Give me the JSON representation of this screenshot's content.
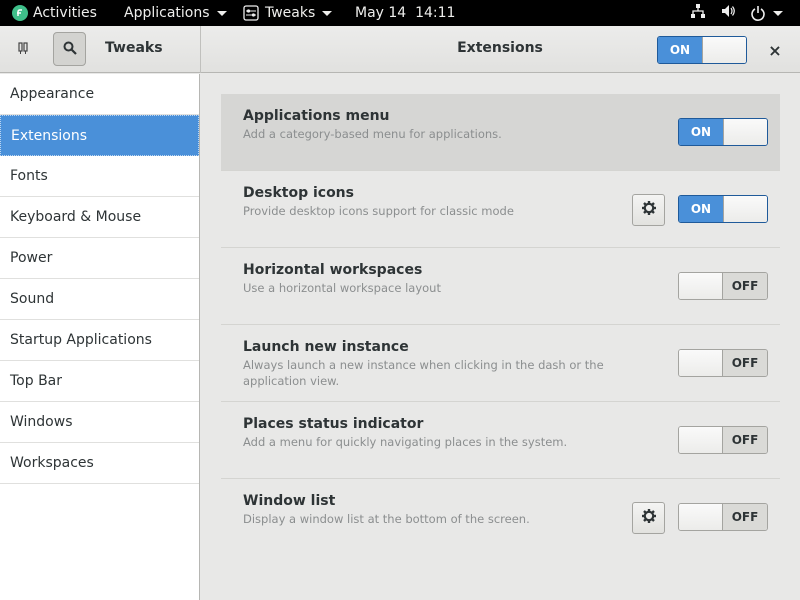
{
  "topbar": {
    "activities": "Activities",
    "applications": "Applications",
    "app_name": "Tweaks",
    "clock": "May 14  14:11"
  },
  "header": {
    "left_title": "Tweaks",
    "title": "Extensions",
    "global_switch": {
      "state": "on",
      "label": "ON"
    },
    "close": "×"
  },
  "sidebar": {
    "items": [
      {
        "label": "Appearance",
        "selected": false
      },
      {
        "label": "Extensions",
        "selected": true
      },
      {
        "label": "Fonts",
        "selected": false
      },
      {
        "label": "Keyboard & Mouse",
        "selected": false
      },
      {
        "label": "Power",
        "selected": false
      },
      {
        "label": "Sound",
        "selected": false
      },
      {
        "label": "Startup Applications",
        "selected": false
      },
      {
        "label": "Top Bar",
        "selected": false
      },
      {
        "label": "Windows",
        "selected": false
      },
      {
        "label": "Workspaces",
        "selected": false
      }
    ]
  },
  "extensions": [
    {
      "title": "Applications menu",
      "desc": "Add a category-based menu for applications.",
      "state": "on",
      "label": "ON",
      "settings": false,
      "highlight": true
    },
    {
      "title": "Desktop icons",
      "desc": "Provide desktop icons support for classic mode",
      "state": "on",
      "label": "ON",
      "settings": true,
      "highlight": false
    },
    {
      "title": "Horizontal workspaces",
      "desc": "Use a horizontal workspace layout",
      "state": "off",
      "label": "OFF",
      "settings": false,
      "highlight": false
    },
    {
      "title": "Launch new instance",
      "desc": "Always launch a new instance when clicking in the dash or the application view.",
      "state": "off",
      "label": "OFF",
      "settings": false,
      "highlight": false
    },
    {
      "title": "Places status indicator",
      "desc": "Add a menu for quickly navigating places in the system.",
      "state": "off",
      "label": "OFF",
      "settings": false,
      "highlight": false
    },
    {
      "title": "Window list",
      "desc": "Display a window list at the bottom of the screen.",
      "state": "off",
      "label": "OFF",
      "settings": true,
      "highlight": false
    }
  ],
  "colors": {
    "accent": "#4a90d9",
    "topbar": "#000000"
  }
}
